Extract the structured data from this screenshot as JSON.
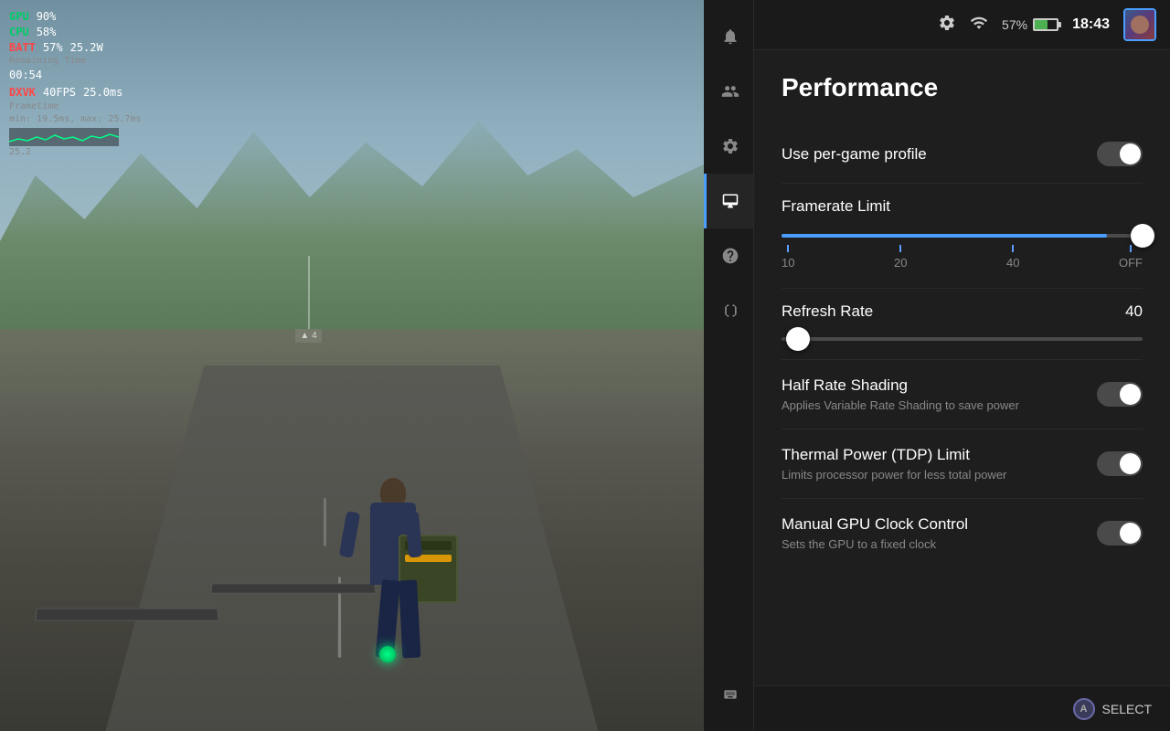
{
  "topbar": {
    "battery_percent": "57%",
    "time": "18:43"
  },
  "sidebar": {
    "items": [
      {
        "id": "notifications",
        "icon": "bell",
        "active": false
      },
      {
        "id": "friends",
        "icon": "people",
        "active": false
      },
      {
        "id": "settings",
        "icon": "gear",
        "active": false
      },
      {
        "id": "display",
        "icon": "display",
        "active": true
      },
      {
        "id": "help",
        "icon": "question",
        "active": false
      },
      {
        "id": "power",
        "icon": "power",
        "active": false
      },
      {
        "id": "keyboard",
        "icon": "keyboard",
        "active": false
      }
    ]
  },
  "performance": {
    "page_title": "Performance",
    "per_game_profile": {
      "label": "Use per-game profile",
      "enabled": true
    },
    "framerate_limit": {
      "label": "Framerate Limit",
      "markers": [
        "10",
        "20",
        "40",
        "OFF"
      ],
      "value": "OFF"
    },
    "refresh_rate": {
      "label": "Refresh Rate",
      "value": "40"
    },
    "half_rate_shading": {
      "label": "Half Rate Shading",
      "sublabel": "Applies Variable Rate Shading to save power",
      "enabled": true
    },
    "thermal_power": {
      "label": "Thermal Power (TDP) Limit",
      "sublabel": "Limits processor power for less total power",
      "enabled": true
    },
    "manual_gpu_clock": {
      "label": "Manual GPU Clock Control",
      "sublabel": "Sets the GPU to a fixed clock",
      "enabled": true
    }
  },
  "hud": {
    "gpu_label": "GPU",
    "gpu_value": "90%",
    "cpu_label": "CPU",
    "cpu_value": "58%",
    "batt_label": "BATT",
    "batt_value": "57%",
    "batt_power": "25.2W",
    "batt_remaining_label": "Remaining Time",
    "batt_time": "00:54",
    "dxvk_label": "DXVK",
    "fps_value": "40FPS",
    "ms_value": "25.0ms",
    "frametime_label": "Frametime",
    "frametime_details": "min: 19.5ms, max: 25.7ms",
    "frametime_value": "25.2"
  },
  "bottombar": {
    "select_btn": "A",
    "select_label": "SELECT"
  }
}
